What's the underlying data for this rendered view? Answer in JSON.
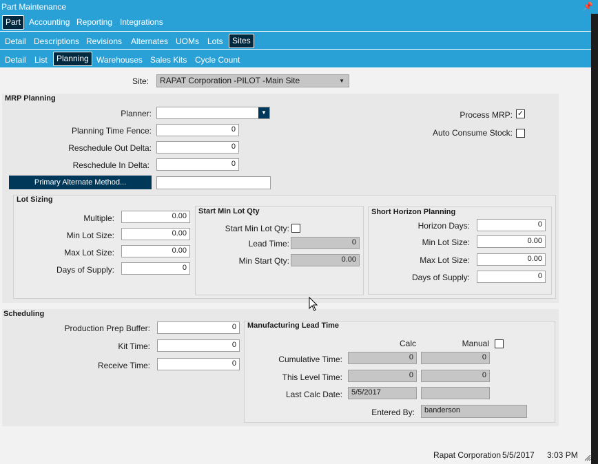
{
  "window": {
    "title": "Part Maintenance"
  },
  "nav": {
    "row1": [
      "Part",
      "Accounting",
      "Reporting",
      "Integrations"
    ],
    "row2": [
      "Detail",
      "Descriptions",
      "Revisions",
      "Alternates",
      "UOMs",
      "Lots",
      "Sites"
    ],
    "row3": [
      "Detail",
      "List",
      "Planning",
      "Warehouses",
      "Sales Kits",
      "Cycle Count"
    ]
  },
  "site": {
    "label": "Site:",
    "value": "RAPAT Corporation -PILOT -Main Site"
  },
  "mrp": {
    "title": "MRP Planning",
    "planner_label": "Planner:",
    "planner_value": "",
    "time_fence_label": "Planning Time Fence:",
    "time_fence_value": "0",
    "resched_out_label": "Reschedule Out Delta:",
    "resched_out_value": "0",
    "resched_in_label": "Reschedule In Delta:",
    "resched_in_value": "0",
    "primary_alt_button": "Primary Alternate Method...",
    "primary_alt_value": "",
    "process_mrp_label": "Process MRP:",
    "process_mrp_checked": true,
    "auto_consume_label": "Auto Consume Stock:",
    "auto_consume_checked": false
  },
  "lot_sizing": {
    "title": "Lot Sizing",
    "multiple_label": "Multiple:",
    "multiple_value": "0.00",
    "min_label": "Min Lot Size:",
    "min_value": "0.00",
    "max_label": "Max Lot Size:",
    "max_value": "0.00",
    "days_label": "Days of Supply:",
    "days_value": "0"
  },
  "start_min": {
    "title": "Start Min Lot Qty",
    "start_label": "Start Min Lot Qty:",
    "start_checked": false,
    "lead_label": "Lead Time:",
    "lead_value": "0",
    "min_start_label": "Min Start Qty:",
    "min_start_value": "0.00"
  },
  "short_horizon": {
    "title": "Short Horizon Planning",
    "horizon_label": "Horizon Days:",
    "horizon_value": "0",
    "min_label": "Min Lot Size:",
    "min_value": "0.00",
    "max_label": "Max Lot Size:",
    "max_value": "0.00",
    "days_label": "Days of Supply:",
    "days_value": "0"
  },
  "scheduling": {
    "title": "Scheduling",
    "prep_label": "Production Prep Buffer:",
    "prep_value": "0",
    "kit_label": "Kit Time:",
    "kit_value": "0",
    "receive_label": "Receive Time:",
    "receive_value": "0"
  },
  "mlt": {
    "title": "Manufacturing Lead Time",
    "calc_label": "Calc",
    "manual_label": "Manual",
    "manual_checked": false,
    "cumulative_label": "Cumulative Time:",
    "cumulative_calc": "0",
    "cumulative_manual": "0",
    "this_level_label": "This Level Time:",
    "this_level_calc": "0",
    "this_level_manual": "0",
    "last_calc_label": "Last Calc Date:",
    "last_calc_value": "5/5/2017",
    "last_calc_manual": "",
    "entered_by_label": "Entered By:",
    "entered_by_value": "banderson"
  },
  "status": {
    "company": "Rapat Corporation",
    "date": "5/5/2017",
    "time": "3:03 PM"
  }
}
